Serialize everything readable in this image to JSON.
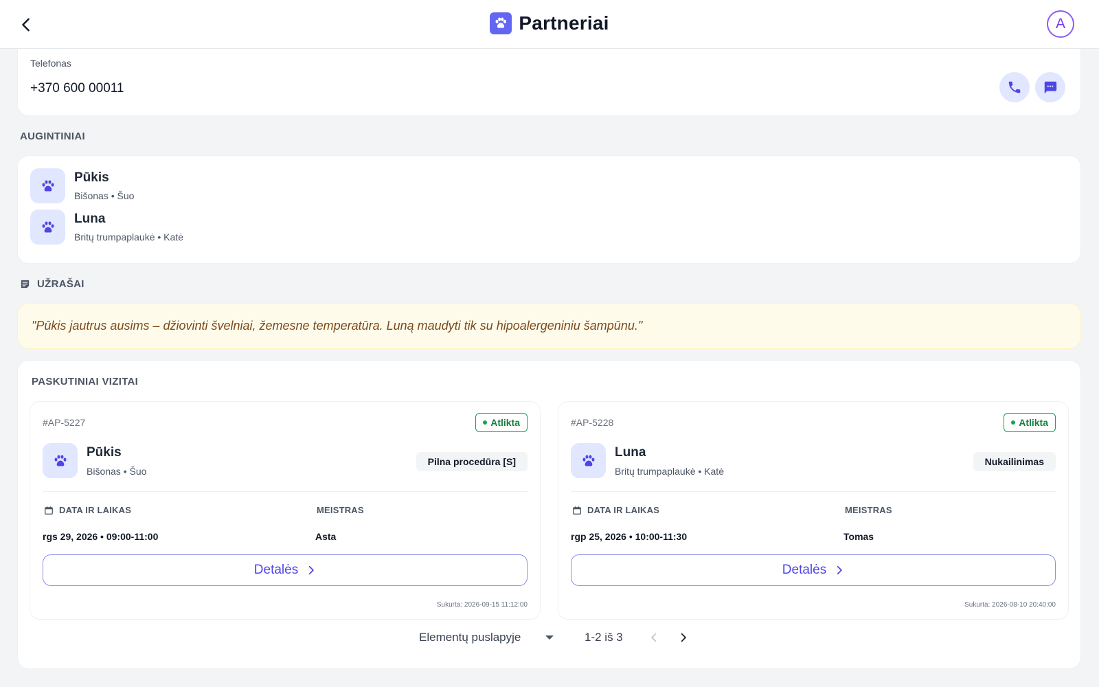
{
  "header": {
    "title": "Partneriai",
    "avatar_initial": "A"
  },
  "contact": {
    "phone_label": "Telefonas",
    "phone_value": "+370 600 00011"
  },
  "pets": {
    "section_title": "AUGINTINIAI",
    "items": [
      {
        "name": "Pūkis",
        "meta": "Bišonas • Šuo"
      },
      {
        "name": "Luna",
        "meta": "Britų trumpaplaukė • Katė"
      }
    ]
  },
  "notes": {
    "section_title": "UŽRAŠAI",
    "text": "\"Pūkis jautrus ausims – džiovinti švelniai, žemesne temperatūra. Luną maudyti tik su hipoalergeniniu šampūnu.\""
  },
  "visits": {
    "section_title": "PASKUTINIAI VIZITAI",
    "items": [
      {
        "id": "#AP-5227",
        "status": "Atlikta",
        "pet_name": "Pūkis",
        "pet_meta": "Bišonas • Šuo",
        "service": "Pilna procedūra [S]",
        "date_label": "DATA IR LAIKAS",
        "date_value": "rgs 29, 2026 • 09:00-11:00",
        "groomer_label": "MEISTRAS",
        "groomer_value": "Asta",
        "details_label": "Detalės",
        "created": "Sukurta: 2026-09-15 11:12:00"
      },
      {
        "id": "#AP-5228",
        "status": "Atlikta",
        "pet_name": "Luna",
        "pet_meta": "Britų trumpaplaukė • Katė",
        "service": "Nukailinimas",
        "date_label": "DATA IR LAIKAS",
        "date_value": "rgp 25, 2026 • 10:00-11:30",
        "groomer_label": "MEISTRAS",
        "groomer_value": "Tomas",
        "details_label": "Detalės",
        "created": "Sukurta: 2026-08-10 20:40:00"
      }
    ],
    "pagination": {
      "per_page_label": "Elementų puslapyje",
      "range": "1-2 iš 3"
    }
  },
  "colors": {
    "accent": "#6366f1",
    "accent_soft": "#e0e7ff",
    "success": "#16a34a",
    "note_bg": "#fffbea"
  }
}
